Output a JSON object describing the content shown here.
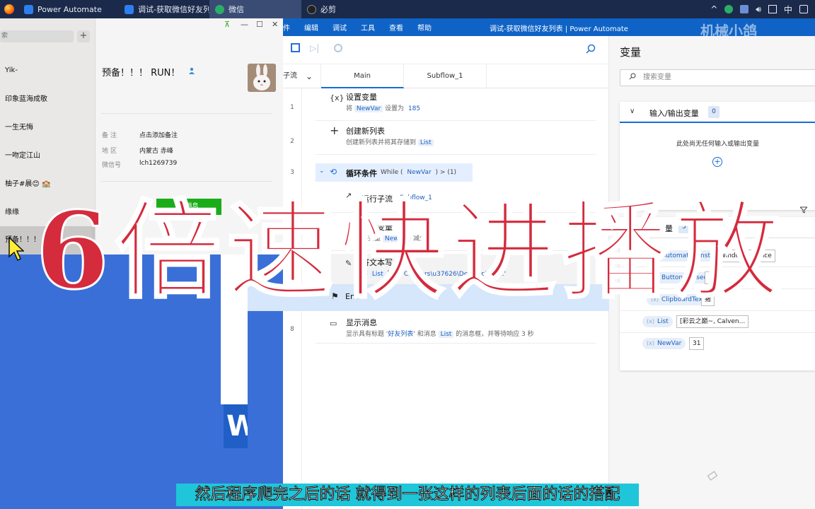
{
  "taskbar": {
    "tasks": [
      {
        "label": "Power Automate"
      },
      {
        "label": "调试-获取微信好友列..."
      },
      {
        "label": "微信"
      },
      {
        "label": "必剪"
      }
    ],
    "tray_chevron": "^",
    "ime": "中"
  },
  "wechat": {
    "search_placeholder": "索",
    "add_label": "+",
    "contacts": [
      {
        "name": "Yik-"
      },
      {
        "name": "印象蓝海成敬"
      },
      {
        "name": "一生无悔"
      },
      {
        "name": "一吻定江山"
      },
      {
        "name": "柚子#晨😊 🏫"
      },
      {
        "name": "缘缘"
      },
      {
        "name": "预备！！！  RUN！"
      }
    ],
    "detail": {
      "name": "预备！！！  RUN！",
      "fields": [
        {
          "label": "备注",
          "value": "点击添加备注"
        },
        {
          "label": "地区",
          "value": "内蒙古 赤峰"
        },
        {
          "label": "微信号",
          "value": "lch1269739"
        }
      ],
      "send_button": "发消息"
    },
    "window_controls": {
      "pin": "⊼",
      "min": "—",
      "max": "☐",
      "close": "✕"
    }
  },
  "desktop": {
    "word_letter": "W"
  },
  "power_automate": {
    "menu": [
      "件",
      "编辑",
      "调试",
      "工具",
      "查看",
      "帮助"
    ],
    "window_title": "调试-获取微信好友列表 | Power Automate",
    "watermark": "机械小鸽",
    "tabs": {
      "left": "子流",
      "main": "Main",
      "sub": "Subflow_1"
    },
    "steps": [
      {
        "line": "1",
        "icon": "{x}",
        "title": "设置变量",
        "sub_pre": "将 ",
        "token1": "NewVar",
        "sub_mid": " 设置为 ",
        "value": "185"
      },
      {
        "line": "2",
        "icon": "+",
        "title": "创建新列表",
        "sub_pre": "创建新列表并将其存储到 ",
        "token1": "List"
      },
      {
        "line": "3",
        "icon": "⟲",
        "title": "循环条件",
        "cond_pre": "While ( ",
        "token1": "NewVar",
        "cond_post": " ) > (1)"
      },
      {
        "line": "4",
        "icon": "↗",
        "title": "运行子流",
        "token1": "Subflow_1"
      },
      {
        "line": "5",
        "icon": "−",
        "title": "减少变量",
        "sub_pre": "将变量 ",
        "token1": "NewVar",
        "sub_mid": " 减少 ",
        "value": "1"
      },
      {
        "line": "6",
        "icon": "✎",
        "title": "将文本写入文件",
        "sub_pre": "将 ",
        "token1": "List",
        "sub_mid": " 写入 ",
        "value": "'C:\\Users\\u37626\\Desktop\\WX...'"
      },
      {
        "line": "7",
        "icon": "⚑",
        "title": "End"
      },
      {
        "line": "8",
        "icon": "▭",
        "title": "显示消息",
        "sub_pre": "显示具有标题 '",
        "token1": "好友列表",
        "sub_mid": "' 和消息 ",
        "token2": "List",
        "sub_post": " 的消息框，并等待响应 3 秒"
      }
    ],
    "variables": {
      "title": "变量",
      "search_placeholder": "搜索变量",
      "io_card": {
        "title": "输入/输出变量",
        "count": "0",
        "empty": "此处尚无任何输入或输出变量",
        "add": "+"
      },
      "flow_card": {
        "title": "流变量",
        "count": "5",
        "items": [
          {
            "name": "AutomationInstance",
            "value": "WindowInstance"
          },
          {
            "name": "ButtonPressed2",
            "value": ""
          },
          {
            "name": "ClipboardText",
            "value": "猪"
          },
          {
            "name": "List",
            "value": "[彩云之巅~, Calven..."
          },
          {
            "name": "NewVar",
            "value": "31"
          }
        ]
      }
    }
  },
  "overlay": {
    "speed_text": "6倍速快进播放"
  },
  "subtitle": "然后程序爬完之后的话 就得到一张这样的列表后面的话的搭配",
  "colors": {
    "pa_blue": "#0f63c6",
    "wechat_green": "#1aad19",
    "overlay_red": "#d42b3d",
    "subtitle_cyan": "#1fc6d9"
  }
}
